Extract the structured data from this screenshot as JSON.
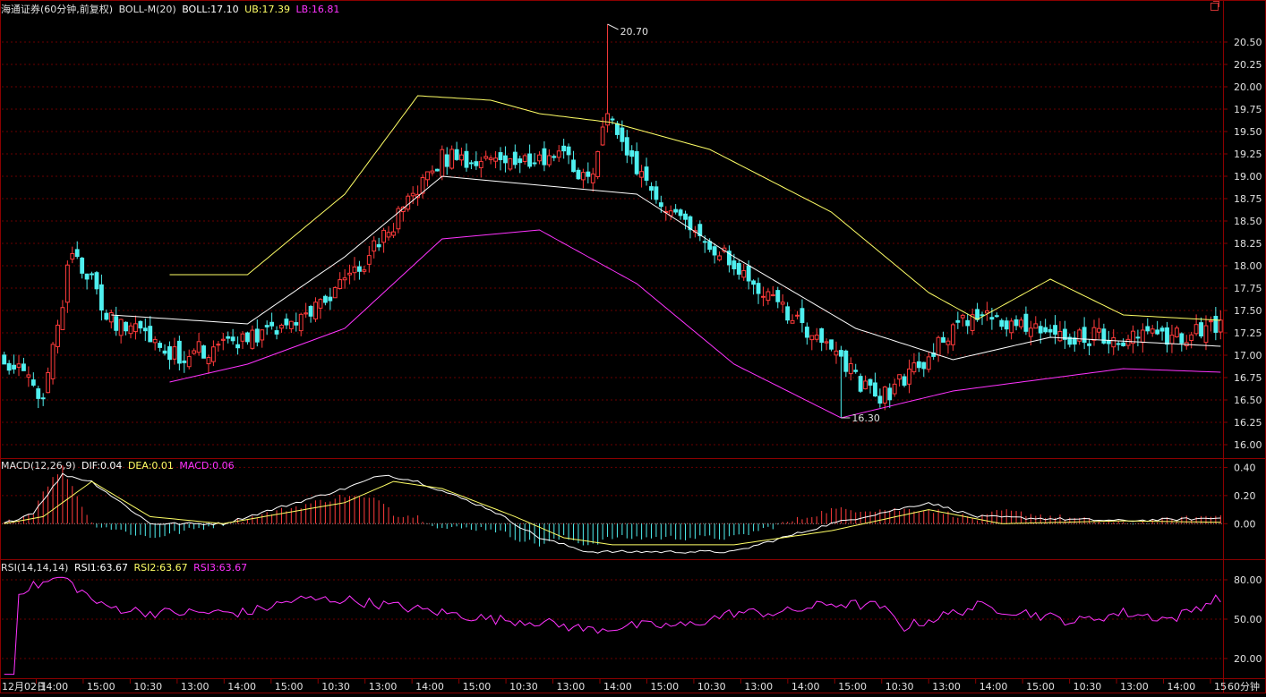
{
  "colors": {
    "background": "#000000",
    "frame": "#8b0000",
    "grid": "#6a0000",
    "axis_text": "#e0e0e0",
    "up_candle": "#ff3b3b",
    "down_candle": "#4ff0f0",
    "boll_mid": "#ffffff",
    "boll_upper": "#ffff66",
    "boll_lower": "#ff33ff",
    "dif": "#ffffff",
    "dea": "#ffff66",
    "rsi": "#ff33ff",
    "label_text": "#e0e0e0"
  },
  "header": {
    "main": {
      "security": "海通证券(60分钟,前复权)",
      "indicator": "BOLL-M(20)",
      "boll": "BOLL:17.10",
      "ub": "UB:17.39",
      "lb": "LB:16.81"
    },
    "macd": {
      "name": "MACD(12,26,9)",
      "dif": "DIF:0.04",
      "dea": "DEA:0.01",
      "macd": "MACD:0.06"
    },
    "rsi": {
      "name": "RSI(14,14,14)",
      "rsi1": "RSI1:63.67",
      "rsi2": "RSI2:63.67",
      "rsi3": "RSI3:63.67"
    }
  },
  "period_label": "60分钟",
  "window_icon": "restore-window-icon",
  "chart_data": [
    {
      "type": "candlestick",
      "panel": "price",
      "ylim": [
        15.85,
        20.85
      ],
      "yticks": [
        "16.00",
        "16.25",
        "16.50",
        "16.75",
        "17.00",
        "17.25",
        "17.50",
        "17.75",
        "18.00",
        "18.25",
        "18.50",
        "18.75",
        "19.00",
        "19.25",
        "19.50",
        "19.75",
        "20.00",
        "20.25",
        "20.50"
      ],
      "bars": 251,
      "max_label": "20.70",
      "min_label": "16.30",
      "key_points": {
        "close": [
          [
            0,
            17.0
          ],
          [
            8,
            16.5
          ],
          [
            14,
            18.2
          ],
          [
            22,
            17.4
          ],
          [
            35,
            17.0
          ],
          [
            60,
            17.3
          ],
          [
            75,
            18.1
          ],
          [
            90,
            19.2
          ],
          [
            115,
            19.2
          ],
          [
            120,
            18.9
          ],
          [
            125,
            19.7
          ],
          [
            130,
            19.0
          ],
          [
            150,
            18.0
          ],
          [
            180,
            16.5
          ],
          [
            190,
            17.0
          ],
          [
            200,
            17.5
          ],
          [
            215,
            17.2
          ],
          [
            240,
            17.2
          ],
          [
            250,
            17.35
          ]
        ],
        "boll_upper": [
          [
            34,
            17.9
          ],
          [
            50,
            17.9
          ],
          [
            70,
            18.8
          ],
          [
            85,
            19.9
          ],
          [
            100,
            19.85
          ],
          [
            110,
            19.7
          ],
          [
            125,
            19.6
          ],
          [
            145,
            19.3
          ],
          [
            170,
            18.6
          ],
          [
            190,
            17.7
          ],
          [
            200,
            17.4
          ],
          [
            215,
            17.85
          ],
          [
            230,
            17.45
          ],
          [
            250,
            17.39
          ]
        ],
        "boll_mid": [
          [
            22,
            17.45
          ],
          [
            50,
            17.35
          ],
          [
            70,
            18.1
          ],
          [
            90,
            19.0
          ],
          [
            110,
            18.9
          ],
          [
            130,
            18.8
          ],
          [
            150,
            18.1
          ],
          [
            175,
            17.3
          ],
          [
            195,
            16.95
          ],
          [
            215,
            17.2
          ],
          [
            250,
            17.1
          ]
        ],
        "boll_lower": [
          [
            34,
            16.7
          ],
          [
            50,
            16.9
          ],
          [
            70,
            17.3
          ],
          [
            90,
            18.3
          ],
          [
            110,
            18.4
          ],
          [
            130,
            17.8
          ],
          [
            150,
            16.9
          ],
          [
            172,
            16.3
          ],
          [
            195,
            16.6
          ],
          [
            230,
            16.85
          ],
          [
            250,
            16.81
          ]
        ]
      }
    },
    {
      "type": "macd",
      "panel": "macd",
      "ylim": [
        -0.24,
        0.46
      ],
      "yticks": [
        "0.00",
        "0.20",
        "0.40"
      ],
      "key_points": {
        "dif": [
          [
            0,
            0.0
          ],
          [
            6,
            0.08
          ],
          [
            12,
            0.35
          ],
          [
            18,
            0.3
          ],
          [
            30,
            0.0
          ],
          [
            45,
            0.0
          ],
          [
            70,
            0.25
          ],
          [
            78,
            0.35
          ],
          [
            85,
            0.3
          ],
          [
            100,
            0.1
          ],
          [
            110,
            -0.1
          ],
          [
            120,
            -0.2
          ],
          [
            130,
            -0.2
          ],
          [
            150,
            -0.2
          ],
          [
            170,
            0.0
          ],
          [
            190,
            0.15
          ],
          [
            200,
            0.05
          ],
          [
            230,
            0.02
          ],
          [
            250,
            0.04
          ]
        ],
        "dea": [
          [
            0,
            0.0
          ],
          [
            8,
            0.05
          ],
          [
            18,
            0.3
          ],
          [
            30,
            0.05
          ],
          [
            45,
            0.0
          ],
          [
            70,
            0.15
          ],
          [
            80,
            0.3
          ],
          [
            90,
            0.25
          ],
          [
            105,
            0.05
          ],
          [
            115,
            -0.1
          ],
          [
            125,
            -0.15
          ],
          [
            150,
            -0.15
          ],
          [
            170,
            -0.05
          ],
          [
            190,
            0.1
          ],
          [
            205,
            0.0
          ],
          [
            230,
            0.02
          ],
          [
            250,
            0.01
          ]
        ]
      }
    },
    {
      "type": "line",
      "panel": "rsi",
      "ylim": [
        5,
        95
      ],
      "yticks": [
        "20.00",
        "50.00",
        "80.00"
      ],
      "key_points": {
        "rsi": [
          [
            0,
            8
          ],
          [
            2,
            8
          ],
          [
            3,
            72
          ],
          [
            6,
            75
          ],
          [
            12,
            82
          ],
          [
            20,
            60
          ],
          [
            30,
            55
          ],
          [
            40,
            55
          ],
          [
            50,
            55
          ],
          [
            60,
            65
          ],
          [
            70,
            65
          ],
          [
            80,
            60
          ],
          [
            90,
            55
          ],
          [
            100,
            50
          ],
          [
            110,
            48
          ],
          [
            120,
            42
          ],
          [
            130,
            45
          ],
          [
            140,
            45
          ],
          [
            150,
            55
          ],
          [
            160,
            55
          ],
          [
            170,
            62
          ],
          [
            180,
            60
          ],
          [
            185,
            44
          ],
          [
            200,
            60
          ],
          [
            210,
            55
          ],
          [
            220,
            48
          ],
          [
            230,
            55
          ],
          [
            240,
            50
          ],
          [
            250,
            67
          ]
        ]
      }
    }
  ],
  "x_axis": {
    "labels": [
      "12月02日",
      "14:00",
      "15:00",
      "10:30",
      "13:00",
      "14:00",
      "15:00",
      "10:30",
      "13:00",
      "14:00",
      "15:00",
      "10:30",
      "13:00",
      "14:00",
      "15:00",
      "10:30",
      "13:00",
      "14:00",
      "15:00",
      "10:30",
      "13:00",
      "14:00",
      "15:00",
      "10:30",
      "13:00",
      "14:00",
      "15"
    ]
  }
}
